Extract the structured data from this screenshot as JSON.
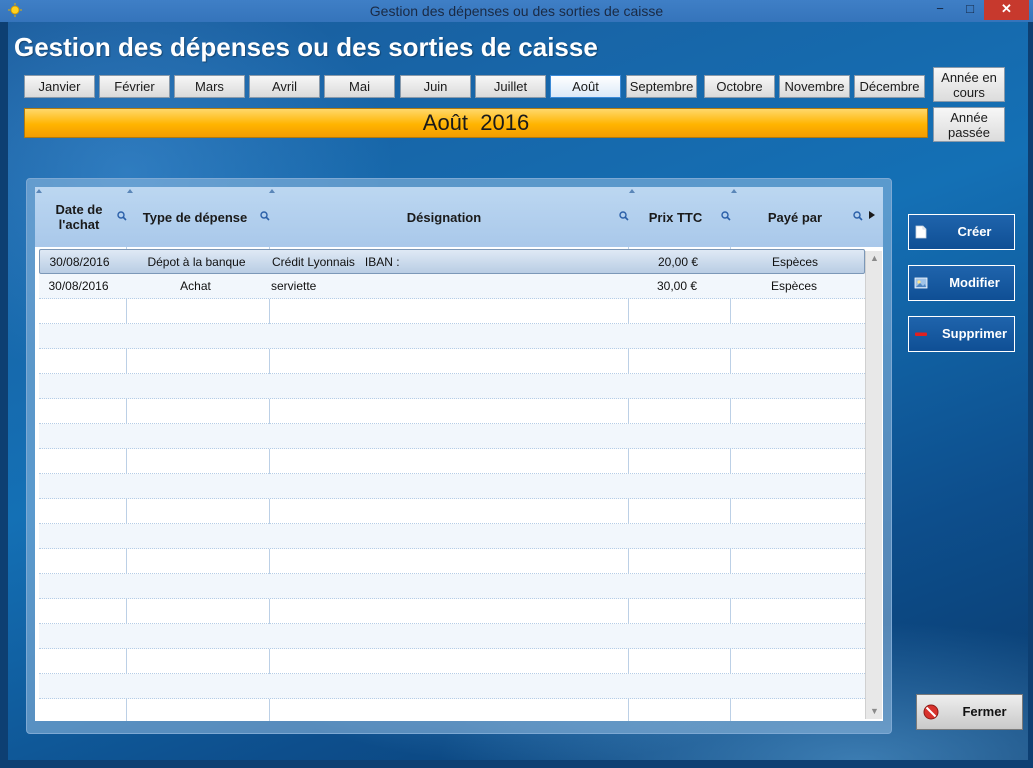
{
  "window": {
    "title": "Gestion des dépenses ou des sorties de caisse",
    "minimize": "−",
    "maximize": "□",
    "close": "✕"
  },
  "header": {
    "title": "Gestion des dépenses ou des sorties de caisse"
  },
  "months": [
    {
      "label": "Janvier"
    },
    {
      "label": "Février"
    },
    {
      "label": "Mars"
    },
    {
      "label": "Avril"
    },
    {
      "label": "Mai"
    },
    {
      "label": "Juin"
    },
    {
      "label": "Juillet"
    },
    {
      "label": "Août"
    },
    {
      "label": "Septembre"
    },
    {
      "label": "Octobre"
    },
    {
      "label": "Novembre"
    },
    {
      "label": "Décembre"
    }
  ],
  "selected_month": "Août",
  "year_buttons": {
    "current": "Année en cours",
    "previous": "Année passée"
  },
  "banner": {
    "month": "Août",
    "year": "2016"
  },
  "table": {
    "columns": [
      "Date de l'achat",
      "Type de dépense",
      "Désignation",
      "Prix TTC",
      "Payé par"
    ],
    "rows": [
      {
        "date": "30/08/2016",
        "type": "Dépot à la banque",
        "designation": "Crédit Lyonnais   IBAN :",
        "prix": "20,00 €",
        "paye_par": "Espèces"
      },
      {
        "date": "30/08/2016",
        "type": "Achat",
        "designation": "serviette",
        "prix": "30,00 €",
        "paye_par": "Espèces"
      }
    ]
  },
  "actions": {
    "create": "Créer",
    "modify": "Modifier",
    "delete": "Supprimer",
    "close": "Fermer"
  },
  "colors": {
    "accent": "#ffb400",
    "window_bg": "#1470b5",
    "button_blue": "#0f4f95"
  }
}
